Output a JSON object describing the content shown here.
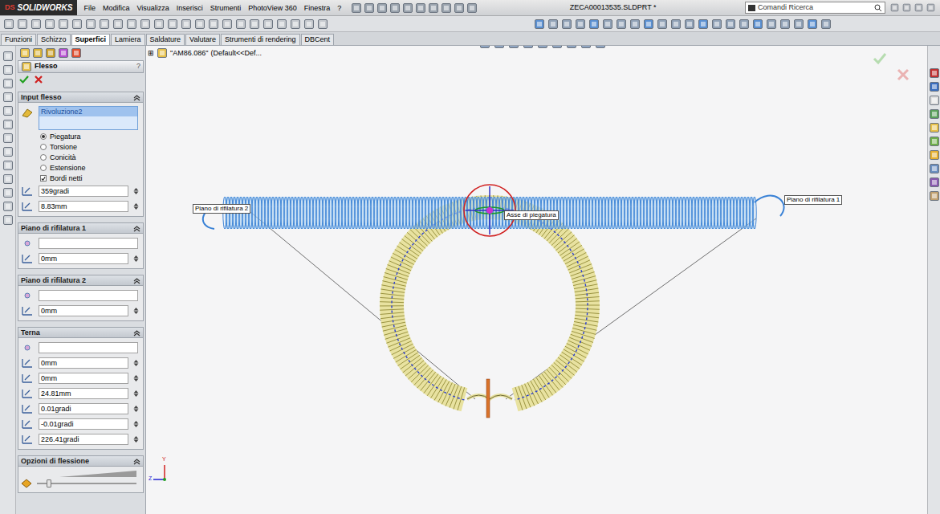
{
  "app": {
    "logo_mark": "DS",
    "logo": "SOLIDWORKS",
    "menu": [
      "File",
      "Modifica",
      "Visualizza",
      "Inserisci",
      "Strumenti",
      "PhotoView 360",
      "Finestra",
      "?"
    ],
    "title": "ZECA00013535.SLDPRT *",
    "search": {
      "placeholder": "Comandi Ricerca"
    }
  },
  "tabs": [
    {
      "label": "Funzioni",
      "selected": false
    },
    {
      "label": "Schizzo",
      "selected": false
    },
    {
      "label": "Superfici",
      "selected": true
    },
    {
      "label": "Lamiera",
      "selected": false
    },
    {
      "label": "Saldature",
      "selected": false
    },
    {
      "label": "Valutare",
      "selected": false
    },
    {
      "label": "Strumenti di rendering",
      "selected": false
    },
    {
      "label": "DBCent",
      "selected": false
    }
  ],
  "property_manager": {
    "title": "Flesso",
    "help": "?",
    "sections": [
      {
        "title": "Input flesso",
        "expanded": true,
        "items": [
          {
            "kind": "list",
            "value": "Rivoluzione2",
            "selected": true
          },
          {
            "kind": "radio",
            "label": "Piegatura",
            "selected": true
          },
          {
            "kind": "radio",
            "label": "Torsione",
            "selected": false
          },
          {
            "kind": "radio",
            "label": "Conicità",
            "selected": false
          },
          {
            "kind": "radio",
            "label": "Estensione",
            "selected": false
          },
          {
            "kind": "checkbox",
            "label": "Bordi netti",
            "checked": true
          },
          {
            "kind": "field",
            "value": "359gradi"
          },
          {
            "kind": "field",
            "value": "8.83mm"
          }
        ]
      },
      {
        "title": "Piano di rifilatura 1",
        "expanded": true,
        "items": [
          {
            "kind": "selector",
            "value": ""
          },
          {
            "kind": "field",
            "value": "0mm"
          }
        ]
      },
      {
        "title": "Piano di rifilatura 2",
        "expanded": true,
        "items": [
          {
            "kind": "selector",
            "value": ""
          },
          {
            "kind": "field",
            "value": "0mm"
          }
        ]
      },
      {
        "title": "Terna",
        "expanded": true,
        "items": [
          {
            "kind": "selector",
            "value": ""
          },
          {
            "kind": "field",
            "value": "0mm"
          },
          {
            "kind": "field",
            "value": "0mm"
          },
          {
            "kind": "field",
            "value": "24.81mm"
          },
          {
            "kind": "field",
            "value": "0.01gradi"
          },
          {
            "kind": "field",
            "value": "-0.01gradi"
          },
          {
            "kind": "field",
            "value": "226.41gradi"
          }
        ]
      },
      {
        "title": "Opzioni di flessione",
        "expanded": true,
        "items": [
          {
            "kind": "slider",
            "level": 0.1
          }
        ]
      }
    ]
  },
  "canvas": {
    "tree_item": "\"AM86.086\"",
    "tree_config": "(Default<<Def...",
    "labels": [
      {
        "text": "Piano di rifilatura 2"
      },
      {
        "text": "Piano di rifilatura 1"
      },
      {
        "text": "Asse di piegatura"
      }
    ],
    "triad": {
      "vertical": "Y",
      "horizontal": "Z"
    }
  }
}
